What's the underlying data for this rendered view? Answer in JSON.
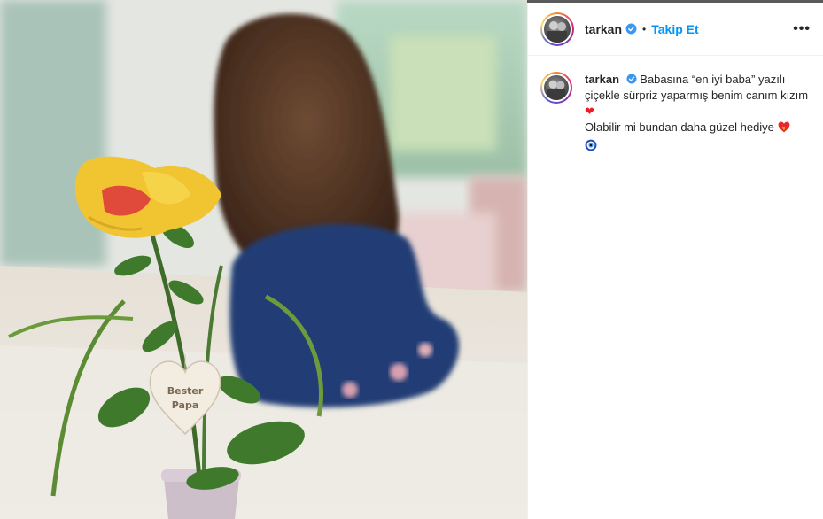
{
  "post": {
    "username": "tarkan",
    "follow_label": "Takip Et",
    "dot": "•",
    "more_label": "•••",
    "caption": {
      "username": "tarkan",
      "line1": "Babasına “en iyi baba” yazılı çiçekle sürpriz yaparmış benim canım kızım",
      "line2": "Olabilir mi bundan daha güzel hediye",
      "heart": "❤"
    }
  },
  "photo": {
    "tag_line1": "Bester",
    "tag_line2": "Papa"
  },
  "colors": {
    "follow": "#0095f6",
    "verified": "#3897f0",
    "heart": "#ed1c24"
  },
  "icons": [
    "verified-badge-icon",
    "more-options-icon",
    "heart-emoji-icon",
    "heart-fire-emoji-icon",
    "evil-eye-emoji-icon"
  ]
}
